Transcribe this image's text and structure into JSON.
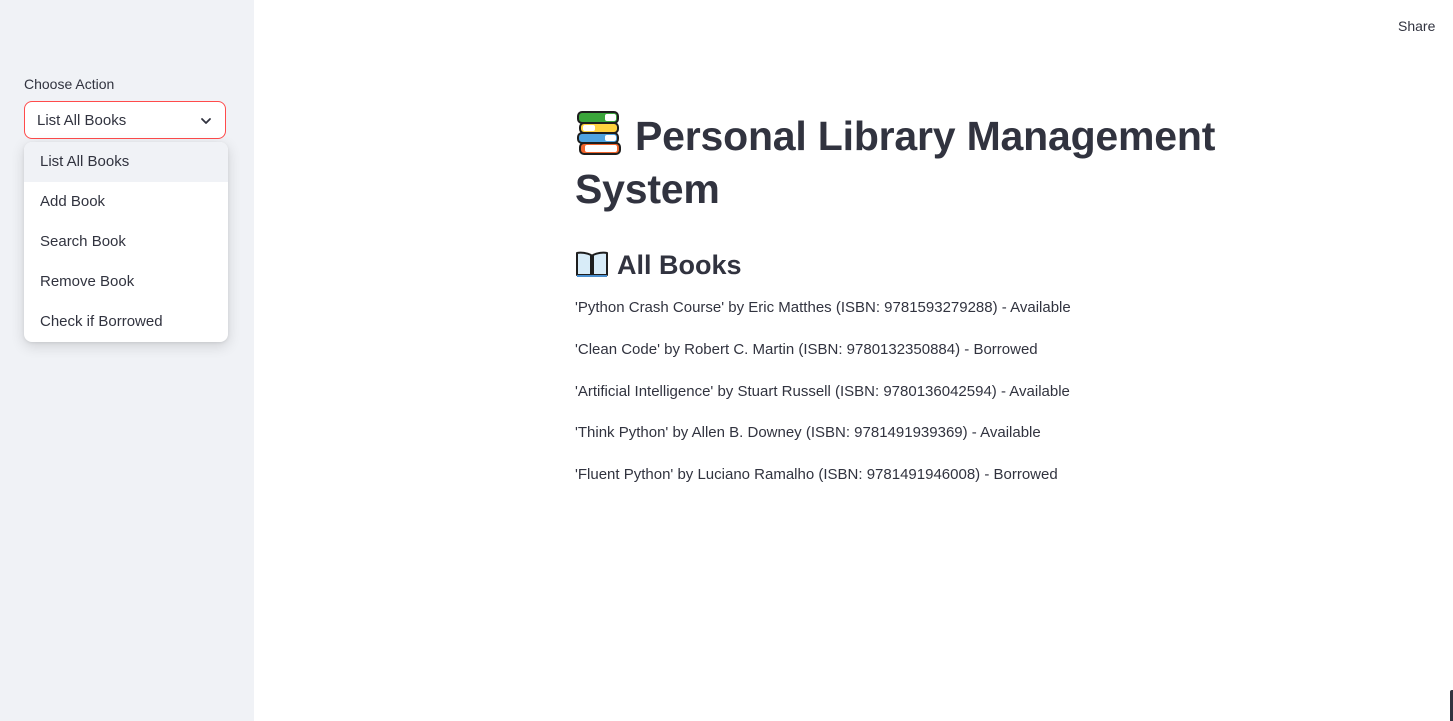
{
  "sidebar": {
    "select_label": "Choose Action",
    "selected_value": "List All Books",
    "options": [
      {
        "label": "List All Books"
      },
      {
        "label": "Add Book"
      },
      {
        "label": "Search Book"
      },
      {
        "label": "Remove Book"
      },
      {
        "label": "Check if Borrowed"
      }
    ]
  },
  "header": {
    "share_label": "Share"
  },
  "main": {
    "title": "Personal Library Management System",
    "title_icon": "books-icon",
    "section_title": "All Books",
    "section_icon": "open-book-icon",
    "books": [
      {
        "text": "'Python Crash Course' by Eric Matthes (ISBN: 9781593279288) - Available"
      },
      {
        "text": "'Clean Code' by Robert C. Martin (ISBN: 9780132350884) - Borrowed"
      },
      {
        "text": "'Artificial Intelligence' by Stuart Russell (ISBN: 9780136042594) - Available"
      },
      {
        "text": "'Think Python' by Allen B. Downey (ISBN: 9781491939369) - Available"
      },
      {
        "text": "'Fluent Python' by Luciano Ramalho (ISBN: 9781491946008) - Borrowed"
      }
    ]
  },
  "colors": {
    "accent": "#ff4b4b",
    "sidebar_bg": "#f0f2f6",
    "text": "#31333f"
  }
}
